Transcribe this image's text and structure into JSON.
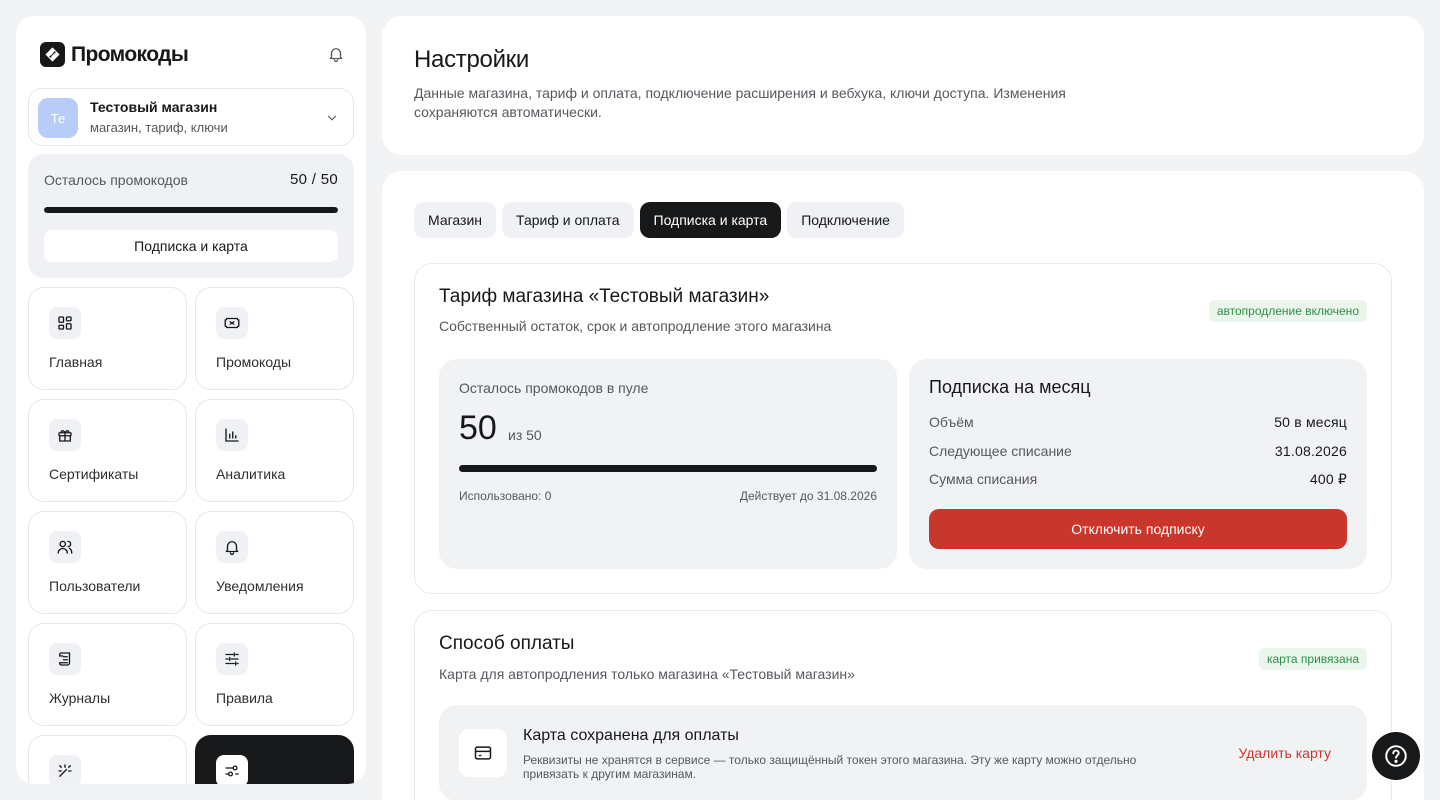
{
  "brand": {
    "name": "Промокоды"
  },
  "store": {
    "avatar": "Те",
    "name": "Тестовый магазин",
    "subtitle": "магазин, тариф, ключи"
  },
  "quota": {
    "label": "Осталось промокодов",
    "value": "50 / 50",
    "fraction": 1.0,
    "button": "Подписка и карта"
  },
  "nav": [
    {
      "label": "Главная",
      "icon": "dashboard-icon"
    },
    {
      "label": "Промокоды",
      "icon": "ticket-icon"
    },
    {
      "label": "Сертификаты",
      "icon": "gift-icon"
    },
    {
      "label": "Аналитика",
      "icon": "bar-chart-icon"
    },
    {
      "label": "Пользователи",
      "icon": "users-icon"
    },
    {
      "label": "Уведомления",
      "icon": "bell-icon"
    },
    {
      "label": "Журналы",
      "icon": "scroll-icon"
    },
    {
      "label": "Правила",
      "icon": "sliders-icon"
    },
    {
      "label": "",
      "icon": "magic-wand-icon"
    },
    {
      "label": "",
      "icon": "settings-icon"
    }
  ],
  "header": {
    "title": "Настройки",
    "description": "Данные магазина, тариф и оплата, подключение расширения и вебхука, ключи доступа. Изменения сохраняются автоматически."
  },
  "tabs": [
    "Магазин",
    "Тариф и оплата",
    "Подписка и карта",
    "Подключение"
  ],
  "active_tab": "Подписка и карта",
  "plan": {
    "title": "Тариф магазина «Тестовый магазин»",
    "subtitle": "Собственный остаток, срок и автопродление этого магазина",
    "badge": "автопродление включено",
    "pool": {
      "label": "Осталось промокодов в пуле",
      "remaining": "50",
      "of": "из 50",
      "fraction": 1.0,
      "used": "Использовано: 0",
      "valid_until": "Действует до 31.08.2026"
    },
    "subscription": {
      "title": "Подписка на месяц",
      "rows": [
        {
          "key": "Объём",
          "value": "50 в месяц"
        },
        {
          "key": "Следующее списание",
          "value": "31.08.2026"
        },
        {
          "key": "Сумма списания",
          "value": "400 ₽"
        }
      ],
      "cancel_button": "Отключить подписку"
    }
  },
  "payment": {
    "title": "Способ оплаты",
    "subtitle": "Карта для автопродления только магазина «Тестовый магазин»",
    "badge": "карта привязана",
    "saved_title": "Карта сохранена для оплаты",
    "saved_desc": "Реквизиты не хранятся в сервисе — только защищённый токен этого магазина. Эту же карту можно отдельно привязать к другим магазинам.",
    "delete_link": "Удалить карту"
  },
  "colors": {
    "accent_dark": "#17181a",
    "danger": "#c9372c",
    "success": "#2f8f45",
    "avatar": "#b7ccf6"
  }
}
